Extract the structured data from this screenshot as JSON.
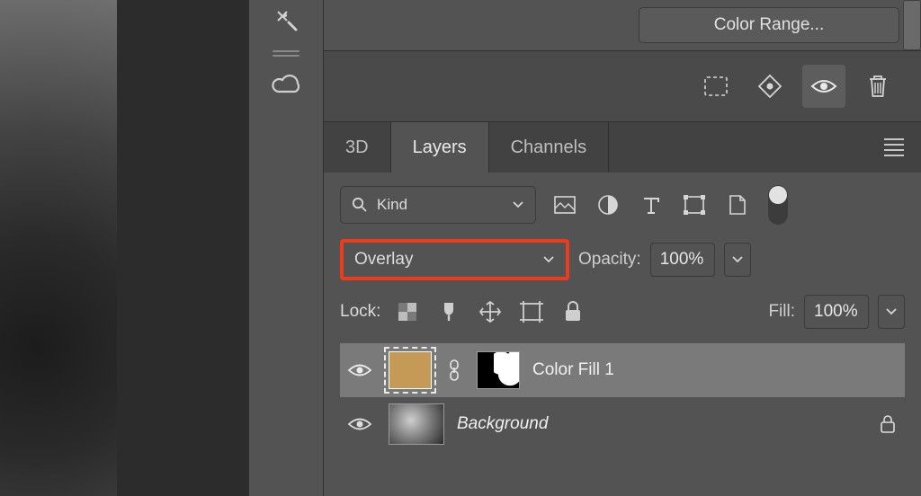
{
  "topPane": {
    "colorRangeBtn": "Color Range..."
  },
  "tabs": {
    "t3d": "3D",
    "layers": "Layers",
    "channels": "Channels",
    "active": "Layers"
  },
  "filter": {
    "kindLabel": "Kind"
  },
  "blend": {
    "mode": "Overlay",
    "opacityLabel": "Opacity:",
    "opacityValue": "100%"
  },
  "lock": {
    "label": "Lock:",
    "fillLabel": "Fill:",
    "fillValue": "100%"
  },
  "layers": {
    "colorFill": "Color Fill 1",
    "background": "Background"
  }
}
